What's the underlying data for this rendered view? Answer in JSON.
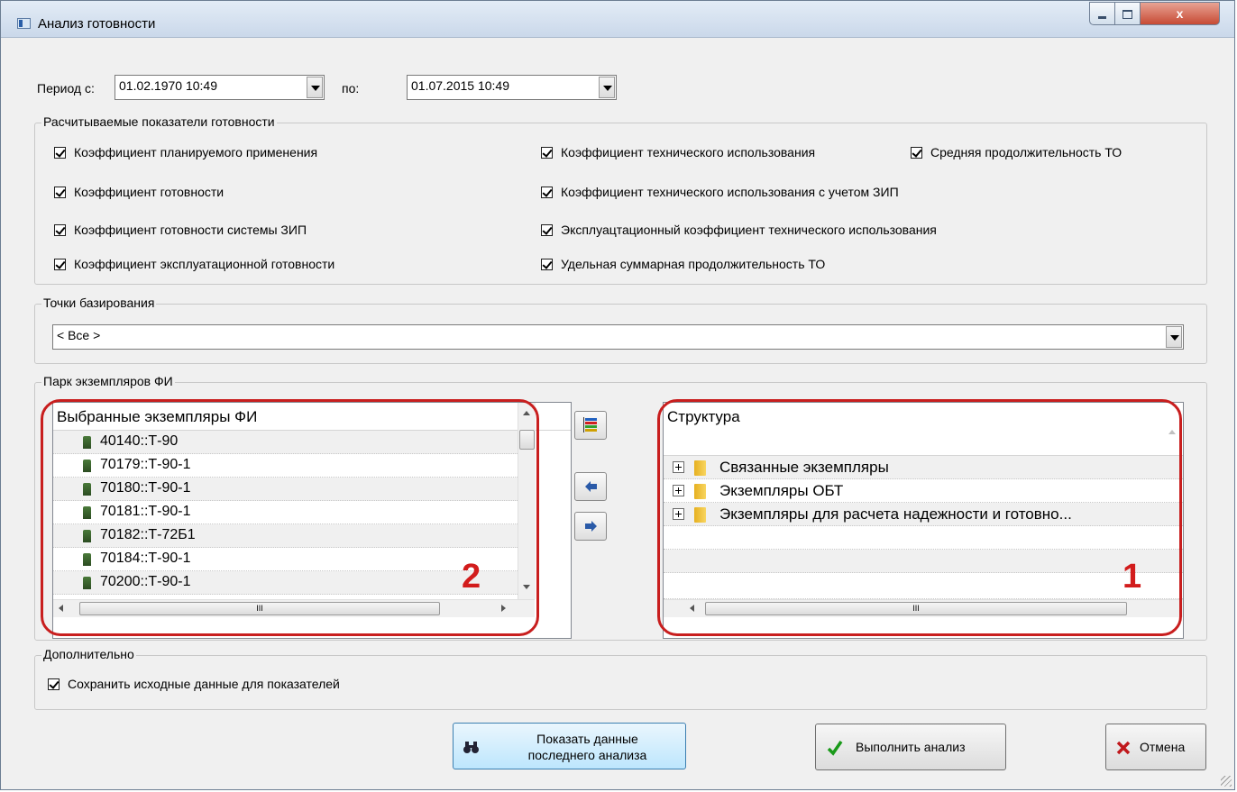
{
  "window": {
    "title": "Анализ готовности",
    "close_label": "x"
  },
  "period": {
    "from_label": "Период с:",
    "from_value": "01.02.1970 10:49",
    "to_label": "по:",
    "to_value": "01.07.2015 10:49"
  },
  "indicators": {
    "title": "Расчитываемые показатели готовности",
    "items": [
      "Коэффициент планируемого применения",
      "Коэффициент готовности",
      "Коэффициент готовности системы ЗИП",
      "Коэффициент эксплуатационной готовности",
      "Коэффициент технического использования",
      "Коэффициент технического использования с учетом ЗИП",
      "Эксплуацтационный коэффициент технического использования",
      "Удельная суммарная продолжительность ТО",
      "Средняя продолжительность ТО"
    ]
  },
  "bases": {
    "title": "Точки базирования",
    "value": "< Все >"
  },
  "park": {
    "title": "Парк экземпляров ФИ",
    "selected_header": "Выбранные экземпляры ФИ",
    "selected_items": [
      "40140::Т-90",
      "70179::Т-90-1",
      "70180::Т-90-1",
      "70181::Т-90-1",
      "70182::Т-72Б1",
      "70184::Т-90-1",
      "70200::Т-90-1"
    ],
    "structure_header": "Структура",
    "structure_items": [
      "Связанные экземпляры",
      "Экземпляры ОБТ",
      "Экземпляры для расчета надежности и готовно..."
    ],
    "hscroll_grip": "III",
    "annotation_left": "2",
    "annotation_right": "1"
  },
  "extra": {
    "title": "Дополнительно",
    "save_label": "Сохранить исходные данные для показателей"
  },
  "buttons": {
    "show_last_line1": "Показать данные",
    "show_last_line2": "последнего анализа",
    "run": "Выполнить анализ",
    "cancel": "Отмена"
  },
  "colors": {
    "annotation": "#c81e1e",
    "accept": "#1a9a1a",
    "cancel": "#c0181c"
  }
}
